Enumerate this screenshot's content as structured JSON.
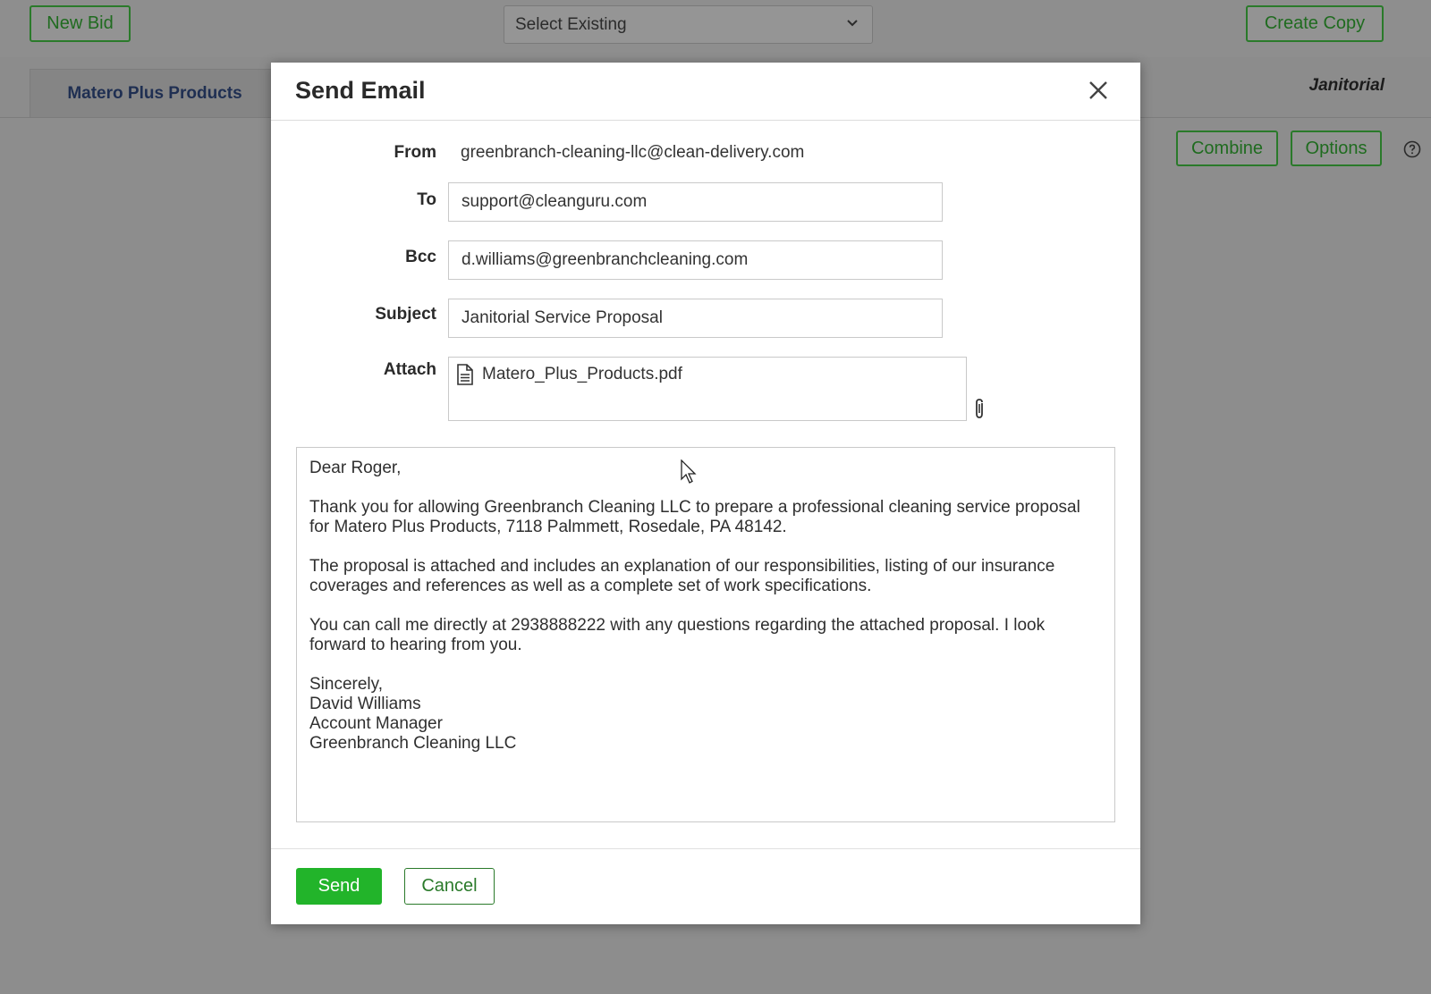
{
  "toolbar": {
    "new_bid_label": "New Bid",
    "select_existing_value": "Select Existing",
    "create_copy_label": "Create Copy"
  },
  "tabs": {
    "customer_tab": "Matero Plus Products",
    "service_label": "Janitorial"
  },
  "actions": {
    "combine_label": "Combine",
    "options_label": "Options"
  },
  "icons": {
    "help": "help-circle-icon",
    "close": "close-icon",
    "file": "file-document-icon",
    "attach": "paperclip-icon",
    "chevron": "chevron-down-icon"
  },
  "colors": {
    "accent_green": "#22b42a",
    "outline_green": "#2a7a2a"
  },
  "modal": {
    "title": "Send Email",
    "labels": {
      "from": "From",
      "to": "To",
      "bcc": "Bcc",
      "subject": "Subject",
      "attach": "Attach"
    },
    "from_value": "greenbranch-cleaning-llc@clean-delivery.com",
    "to_value": "support@cleanguru.com",
    "bcc_value": "d.williams@greenbranchcleaning.com",
    "subject_value": "Janitorial Service Proposal",
    "attachment_name": "Matero_Plus_Products.pdf",
    "body": {
      "greeting": "Dear Roger,",
      "para1": "Thank you for allowing Greenbranch Cleaning LLC to prepare a professional cleaning service proposal for Matero Plus Products, 7118 Palmmett, Rosedale, PA 48142.",
      "para2": "The proposal is attached and includes an explanation of our responsibilities, listing of our insurance coverages and references as well as a complete set of work specifications.",
      "para3": "You can call me directly at 2938888222 with any questions regarding the attached proposal.  I look forward to hearing from you.",
      "closing": "Sincerely,",
      "sig_name": "David Williams",
      "sig_title": "Account Manager",
      "sig_company": "Greenbranch Cleaning LLC"
    },
    "send_label": "Send",
    "cancel_label": "Cancel"
  }
}
